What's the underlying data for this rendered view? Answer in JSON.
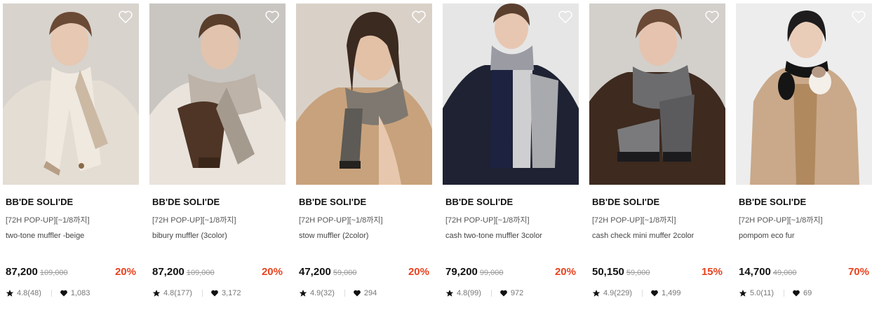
{
  "colors": {
    "discount": "#e8431f",
    "brand_text": "#111111",
    "muted_text": "#777777",
    "original_price": "#999999"
  },
  "products": [
    {
      "brand": "BB'DE SOLI'DE",
      "tag": "[72H POP-UP][~1/8까지]",
      "name": "two-tone muffler -beige",
      "price": "87,200",
      "original_price": "109,000",
      "discount": "20%",
      "rating": "4.8(48)",
      "likes": "1,083",
      "wish_icon": "heart-outline-icon"
    },
    {
      "brand": "BB'DE SOLI'DE",
      "tag": "[72H POP-UP][~1/8까지]",
      "name": "bibury muffler (3color)",
      "price": "87,200",
      "original_price": "109,000",
      "discount": "20%",
      "rating": "4.8(177)",
      "likes": "3,172",
      "wish_icon": "heart-outline-icon"
    },
    {
      "brand": "BB'DE SOLI'DE",
      "tag": "[72H POP-UP][~1/8까지]",
      "name": "stow muffler (2color)",
      "price": "47,200",
      "original_price": "59,000",
      "discount": "20%",
      "rating": "4.9(32)",
      "likes": "294",
      "wish_icon": "heart-outline-icon"
    },
    {
      "brand": "BB'DE SOLI'DE",
      "tag": "[72H POP-UP][~1/8까지]",
      "name": "cash two-tone muffler 3color",
      "price": "79,200",
      "original_price": "99,000",
      "discount": "20%",
      "rating": "4.8(99)",
      "likes": "972",
      "wish_icon": "heart-outline-icon"
    },
    {
      "brand": "BB'DE SOLI'DE",
      "tag": "[72H POP-UP][~1/8까지]",
      "name": "cash check mini muffer 2color",
      "price": "50,150",
      "original_price": "59,000",
      "discount": "15%",
      "rating": "4.9(229)",
      "likes": "1,499",
      "wish_icon": "heart-outline-icon"
    },
    {
      "brand": "BB'DE SOLI'DE",
      "tag": "[72H POP-UP][~1/8까지]",
      "name": "pompom eco fur",
      "price": "14,700",
      "original_price": "49,000",
      "discount": "70%",
      "rating": "5.0(11)",
      "likes": "69",
      "wish_icon": "heart-outline-icon"
    }
  ]
}
